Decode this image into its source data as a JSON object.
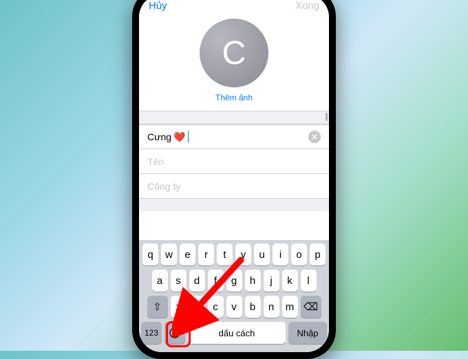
{
  "nav": {
    "cancel": "Hủy",
    "done": "Xong"
  },
  "avatar": {
    "letter": "C",
    "add_photo": "Thêm ảnh"
  },
  "fields": {
    "name_value": "Cưng",
    "heart": "❤️",
    "last_name_ph": "Tên",
    "company_ph": "Công ty"
  },
  "keyboard": {
    "row1": [
      "q",
      "w",
      "e",
      "r",
      "t",
      "y",
      "u",
      "i",
      "o",
      "p"
    ],
    "row2": [
      "a",
      "s",
      "d",
      "f",
      "g",
      "h",
      "j",
      "k",
      "l"
    ],
    "row3": [
      "z",
      "x",
      "c",
      "v",
      "b",
      "n",
      "m"
    ],
    "shift": "⇧",
    "backspace": "⌫",
    "num": "123",
    "emoji": "☺",
    "space": "dấu cách",
    "return": "Nhập"
  }
}
